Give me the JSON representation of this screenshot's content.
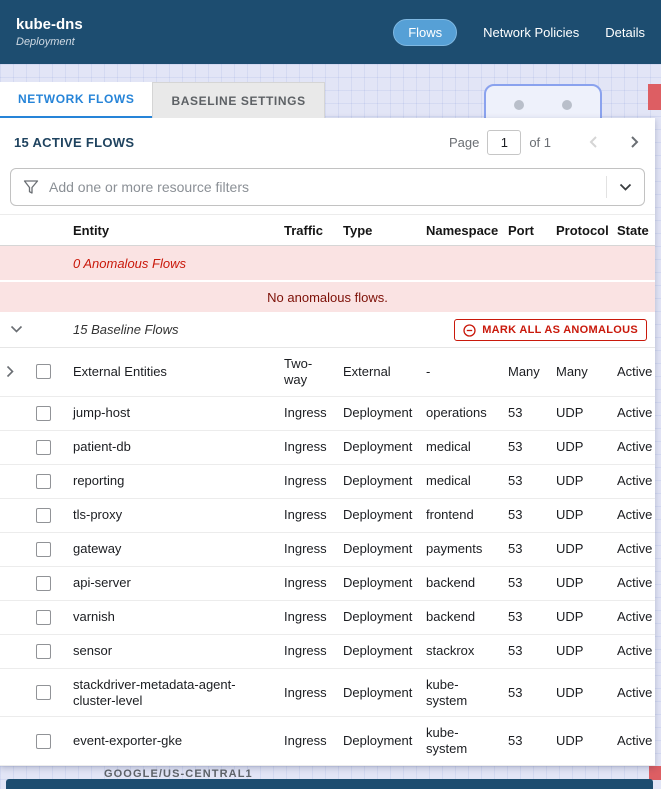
{
  "header": {
    "title": "kube-dns",
    "subtitle": "Deployment",
    "nav": [
      {
        "label": "Flows",
        "active": true
      },
      {
        "label": "Network Policies",
        "active": false
      },
      {
        "label": "Details",
        "active": false
      }
    ]
  },
  "tabs": [
    {
      "label": "NETWORK FLOWS",
      "active": true
    },
    {
      "label": "BASELINE SETTINGS",
      "active": false
    }
  ],
  "panel": {
    "title": "15 ACTIVE FLOWS",
    "pagination": {
      "page_label": "Page",
      "page_value": "1",
      "of_label": "of 1"
    }
  },
  "filter": {
    "placeholder": "Add one or more resource filters",
    "icon": "filter-funnel-icon",
    "dropdown_icon": "chevron-down-icon"
  },
  "table": {
    "columns": [
      "Entity",
      "Traffic",
      "Type",
      "Namespace",
      "Port",
      "Protocol",
      "State"
    ],
    "anomalous": {
      "header": "0 Anomalous Flows",
      "empty_message": "No anomalous flows."
    },
    "baseline": {
      "header": "15 Baseline Flows",
      "mark_all_label": "MARK ALL AS ANOMALOUS",
      "mark_all_icon": "minus-circle-icon"
    },
    "rows": [
      {
        "entity": "External Entities",
        "traffic": "Two-way",
        "type": "External",
        "namespace": "-",
        "port": "Many",
        "protocol": "Many",
        "state": "Active",
        "expandable": true
      },
      {
        "entity": "jump-host",
        "traffic": "Ingress",
        "type": "Deployment",
        "namespace": "operations",
        "port": "53",
        "protocol": "UDP",
        "state": "Active"
      },
      {
        "entity": "patient-db",
        "traffic": "Ingress",
        "type": "Deployment",
        "namespace": "medical",
        "port": "53",
        "protocol": "UDP",
        "state": "Active"
      },
      {
        "entity": "reporting",
        "traffic": "Ingress",
        "type": "Deployment",
        "namespace": "medical",
        "port": "53",
        "protocol": "UDP",
        "state": "Active"
      },
      {
        "entity": "tls-proxy",
        "traffic": "Ingress",
        "type": "Deployment",
        "namespace": "frontend",
        "port": "53",
        "protocol": "UDP",
        "state": "Active"
      },
      {
        "entity": "gateway",
        "traffic": "Ingress",
        "type": "Deployment",
        "namespace": "payments",
        "port": "53",
        "protocol": "UDP",
        "state": "Active"
      },
      {
        "entity": "api-server",
        "traffic": "Ingress",
        "type": "Deployment",
        "namespace": "backend",
        "port": "53",
        "protocol": "UDP",
        "state": "Active"
      },
      {
        "entity": "varnish",
        "traffic": "Ingress",
        "type": "Deployment",
        "namespace": "backend",
        "port": "53",
        "protocol": "UDP",
        "state": "Active"
      },
      {
        "entity": "sensor",
        "traffic": "Ingress",
        "type": "Deployment",
        "namespace": "stackrox",
        "port": "53",
        "protocol": "UDP",
        "state": "Active"
      },
      {
        "entity": "stackdriver-metadata-agent-cluster-level",
        "traffic": "Ingress",
        "type": "Deployment",
        "namespace": "kube-system",
        "port": "53",
        "protocol": "UDP",
        "state": "Active"
      },
      {
        "entity": "event-exporter-gke",
        "traffic": "Ingress",
        "type": "Deployment",
        "namespace": "kube-system",
        "port": "53",
        "protocol": "UDP",
        "state": "Active"
      }
    ]
  },
  "background": {
    "cluster_label": "GOOGLE/US-CENTRAL1"
  },
  "colors": {
    "header_bg": "#1d4d70",
    "flows_pill": "#56a0d6",
    "tab_active_text": "#2684d8",
    "danger": "#c9190b",
    "anomalous_row_bg": "#fae3e3",
    "canvas_bg": "#e2e5f6",
    "anomalous_marker": "#dd5e63"
  }
}
